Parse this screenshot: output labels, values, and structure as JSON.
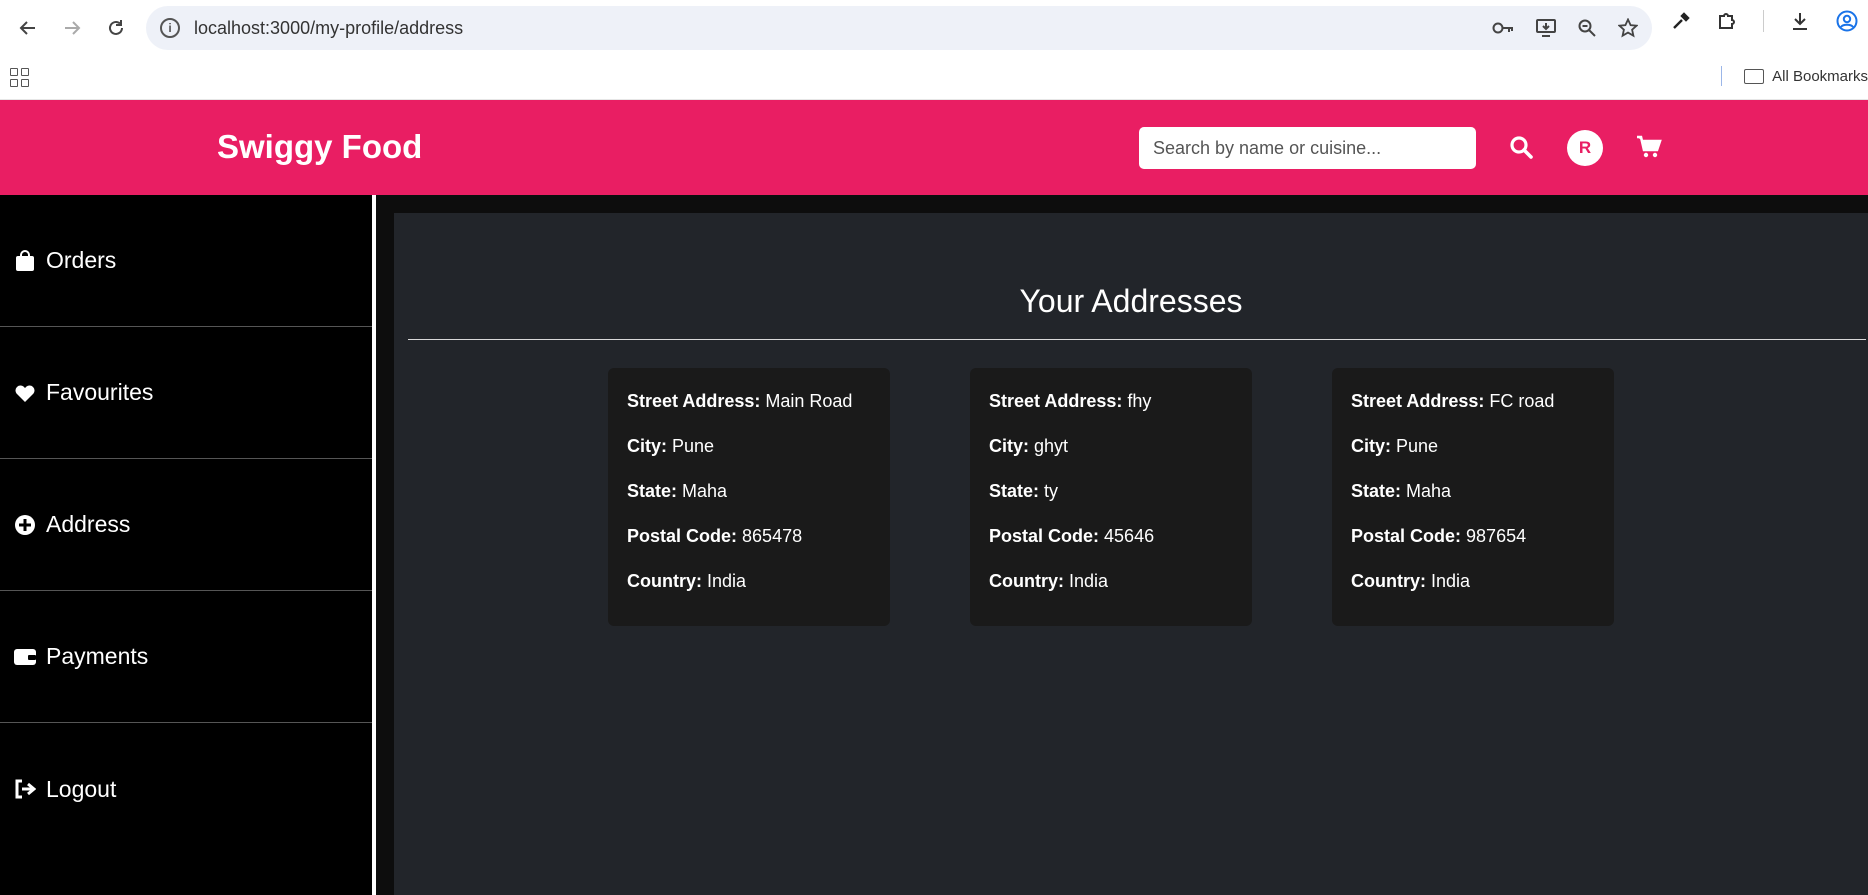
{
  "browser": {
    "url": "localhost:3000/my-profile/address",
    "bookmarks_label": "All Bookmarks"
  },
  "header": {
    "brand": "Swiggy Food",
    "search_placeholder": "Search by name or cuisine...",
    "avatar_initial": "R",
    "accent_color": "#e91e63"
  },
  "sidebar": {
    "items": [
      {
        "label": "Orders",
        "icon": "shopping-bag-icon"
      },
      {
        "label": "Favourites",
        "icon": "heart-icon"
      },
      {
        "label": "Address",
        "icon": "plus-circle-icon"
      },
      {
        "label": "Payments",
        "icon": "wallet-icon"
      },
      {
        "label": "Logout",
        "icon": "sign-out-icon"
      }
    ]
  },
  "main": {
    "title": "Your Addresses",
    "labels": {
      "street": "Street Address:",
      "city": "City:",
      "state": "State:",
      "postal": "Postal Code:",
      "country": "Country:"
    },
    "addresses": [
      {
        "street": "Main Road",
        "city": "Pune",
        "state": "Maha",
        "postal": "865478",
        "country": "India"
      },
      {
        "street": "fhy",
        "city": "ghyt",
        "state": "ty",
        "postal": "45646",
        "country": "India"
      },
      {
        "street": "FC road",
        "city": "Pune",
        "state": "Maha",
        "postal": "987654",
        "country": "India"
      }
    ]
  }
}
